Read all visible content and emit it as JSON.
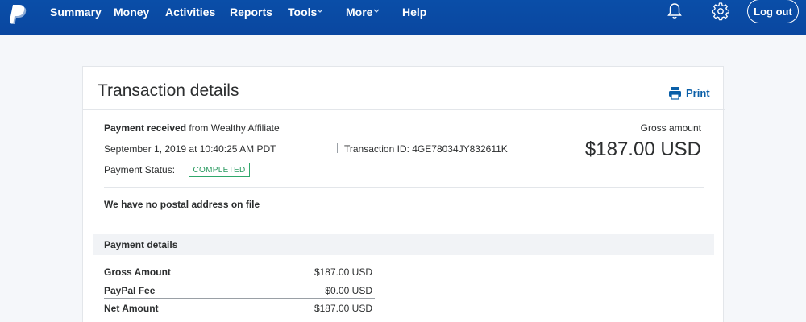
{
  "nav": {
    "items": [
      {
        "label": "Summary",
        "has_dropdown": false
      },
      {
        "label": "Money",
        "has_dropdown": false
      },
      {
        "label": "Activities",
        "has_dropdown": false
      },
      {
        "label": "Reports",
        "has_dropdown": false
      },
      {
        "label": "Tools",
        "has_dropdown": true
      },
      {
        "label": "More",
        "has_dropdown": true
      },
      {
        "label": "Help",
        "has_dropdown": false
      }
    ],
    "logout_label": "Log out",
    "icons": [
      "paypal-logo-icon",
      "bell-icon",
      "gear-icon",
      "chevron-down-icon"
    ]
  },
  "colors": {
    "nav_bg": "#0a4ea8",
    "status_green": "#2fa86b",
    "link_blue": "#0a5fa8"
  },
  "transaction": {
    "title": "Transaction details",
    "print_label": "Print",
    "payment_received": "Payment received",
    "from_text": "from Wealthy Affiliate",
    "date": "September 1, 2019 at 10:40:25 AM PDT",
    "transaction_id": "Transaction ID: 4GE78034JY832611K",
    "status_label": "Payment Status:",
    "status_value": "COMPLETED",
    "gross_label": "Gross amount",
    "gross_amount": "$187.00 USD",
    "postal_note": "We have no postal address on file"
  },
  "payment_details": {
    "title": "Payment details",
    "rows": [
      {
        "label": "Gross Amount",
        "value": "$187.00 USD"
      },
      {
        "label": "PayPal Fee",
        "value": "$0.00 USD"
      },
      {
        "label": "Net Amount",
        "value": "$187.00 USD"
      }
    ]
  }
}
